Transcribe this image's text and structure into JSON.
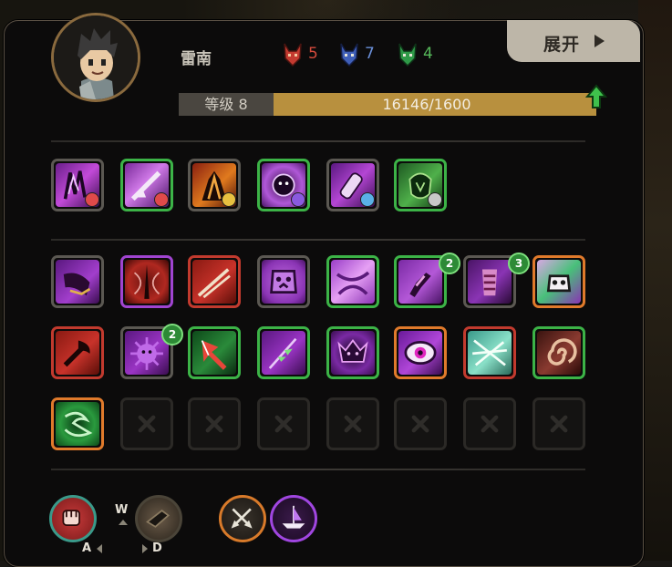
{
  "character": {
    "name": "雷南",
    "level_label": "等级 8",
    "xp_text": "16146/1600"
  },
  "resources": [
    {
      "icon": "red-demon-icon",
      "value": "5",
      "color": "#d34a3c"
    },
    {
      "icon": "blue-demon-icon",
      "value": "7",
      "color": "#6a8fd8"
    },
    {
      "icon": "green-demon-icon",
      "value": "4",
      "color": "#56b85a"
    }
  ],
  "expand_button": {
    "label": "展开"
  },
  "badges": {
    "slot_r1_6": "2",
    "slot_r1_7": "3",
    "slot_r2_2": "2"
  },
  "keys": {
    "a": "A",
    "w": "W",
    "d": "D"
  }
}
